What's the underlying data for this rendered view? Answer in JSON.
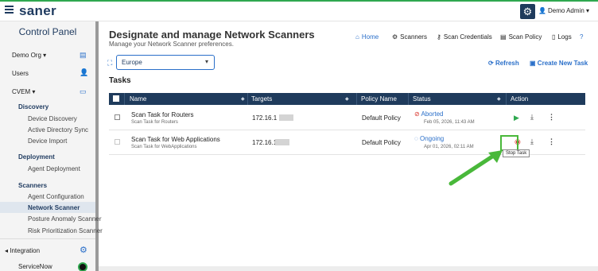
{
  "brand": {
    "name": "saner"
  },
  "header": {
    "user_name": "Demo Admin"
  },
  "sidebar": {
    "title": "Control Panel",
    "org": "Demo Org",
    "users": "Users",
    "cvem": "CVEM",
    "sections": [
      {
        "heading": "Discovery",
        "items": [
          "Device Discovery",
          "Active Directory Sync",
          "Device Import"
        ]
      },
      {
        "heading": "Deployment",
        "items": [
          "Agent Deployment"
        ]
      },
      {
        "heading": "Scanners",
        "items": [
          "Agent Configuration",
          "Network Scanner",
          "Posture Anomaly Scanner",
          "Risk Prioritization Scanner"
        ]
      }
    ],
    "integration": "Integration",
    "servicenow": "ServiceNow"
  },
  "page": {
    "title": "Designate and manage Network Scanners",
    "subtitle": "Manage your Network Scanner preferences."
  },
  "topnav": {
    "home": "Home",
    "scanners": "Scanners",
    "scan_credentials": "Scan Credentials",
    "scan_policy": "Scan Policy",
    "logs": "Logs"
  },
  "scope_select": {
    "value": "Europe"
  },
  "actions": {
    "refresh": "Refresh",
    "create_task": "Create New Task"
  },
  "tasks": {
    "heading": "Tasks",
    "columns": [
      "Name",
      "Targets",
      "Policy Name",
      "Status",
      "Action"
    ],
    "rows": [
      {
        "name": "Scan Task for Routers",
        "name_sub": "Scan Task for Routers",
        "target": "172.16.1",
        "policy": "Default Policy",
        "status": "Aborted",
        "status_time": "Feb 05, 2026, 11:43 AM"
      },
      {
        "name": "Scan Task for Web Applications",
        "name_sub": "Scan Task for WebApplications",
        "target": "172.16.1",
        "policy": "Default Policy",
        "status": "Ongoing",
        "status_time": "Apr 01, 2026, 02:11 AM"
      }
    ]
  },
  "tooltip": {
    "stop_task": "Stop Task"
  },
  "colors": {
    "navy": "#1f3b5c",
    "accent": "#2a6fc9",
    "highlight": "#49b83a",
    "danger": "#d9342b"
  }
}
